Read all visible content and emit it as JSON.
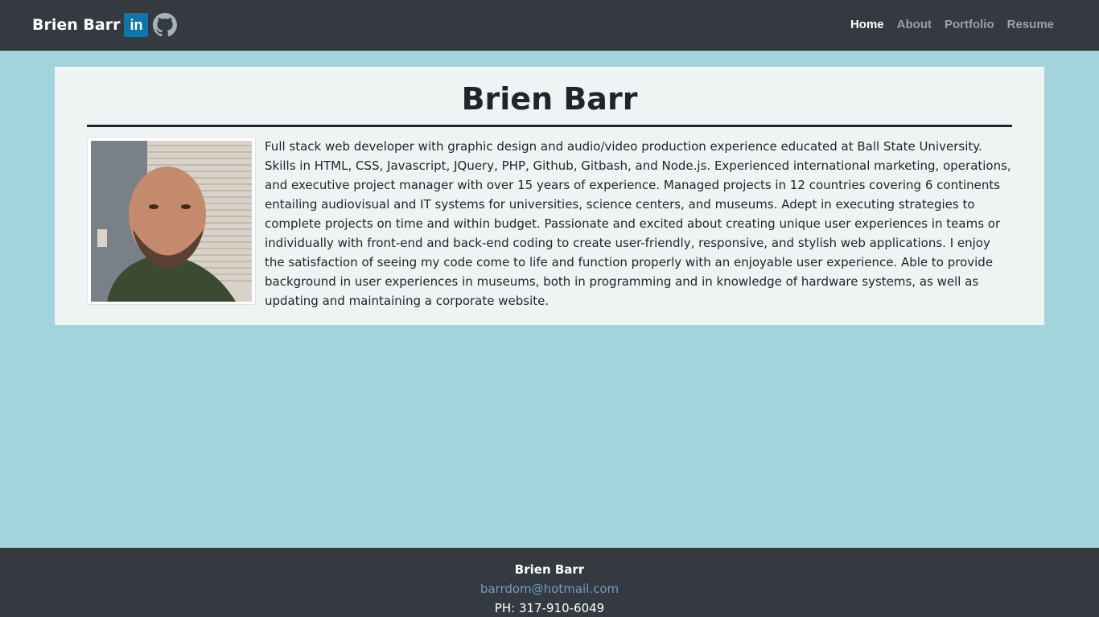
{
  "navbar": {
    "brand": "Brien Barr",
    "linkedin_icon": "linkedin-icon",
    "linkedin_text": "in",
    "github_icon": "github-icon",
    "links": [
      {
        "label": "Home",
        "active": true
      },
      {
        "label": "About",
        "active": false
      },
      {
        "label": "Portfolio",
        "active": false
      },
      {
        "label": "Resume",
        "active": false
      }
    ]
  },
  "main": {
    "title": "Brien Barr",
    "bio": "Full stack web developer with graphic design and audio/video production experience educated at Ball State University. Skills in HTML, CSS, Javascript, JQuery, PHP, Github, Gitbash, and Node.js. Experienced international marketing, operations, and executive project manager with over 15 years of experience. Managed projects in 12 countries covering 6 continents entailing audiovisual and IT systems for universities, science centers, and museums. Adept in executing strategies to complete projects on time and within budget. Passionate and excited about creating unique user experiences in teams or individually with front-end and back-end coding to create user-friendly, responsive, and stylish web applications. I enjoy the satisfaction of seeing my code come to life and function properly with an enjoyable user experience. Able to provide background in user experiences in museums, both in programming and in knowledge of hardware systems, as well as updating and maintaining a corporate website."
  },
  "footer": {
    "name": "Brien Barr",
    "email": "barrdom@hotmail.com",
    "phone": "PH: 317-910-6049"
  },
  "colors": {
    "navbar_bg": "#343a40",
    "page_bg": "#a3d4dc",
    "card_bg": "#eff3f4",
    "linkedin_blue": "#0e76a8",
    "link_blue": "#6e9dc9"
  }
}
